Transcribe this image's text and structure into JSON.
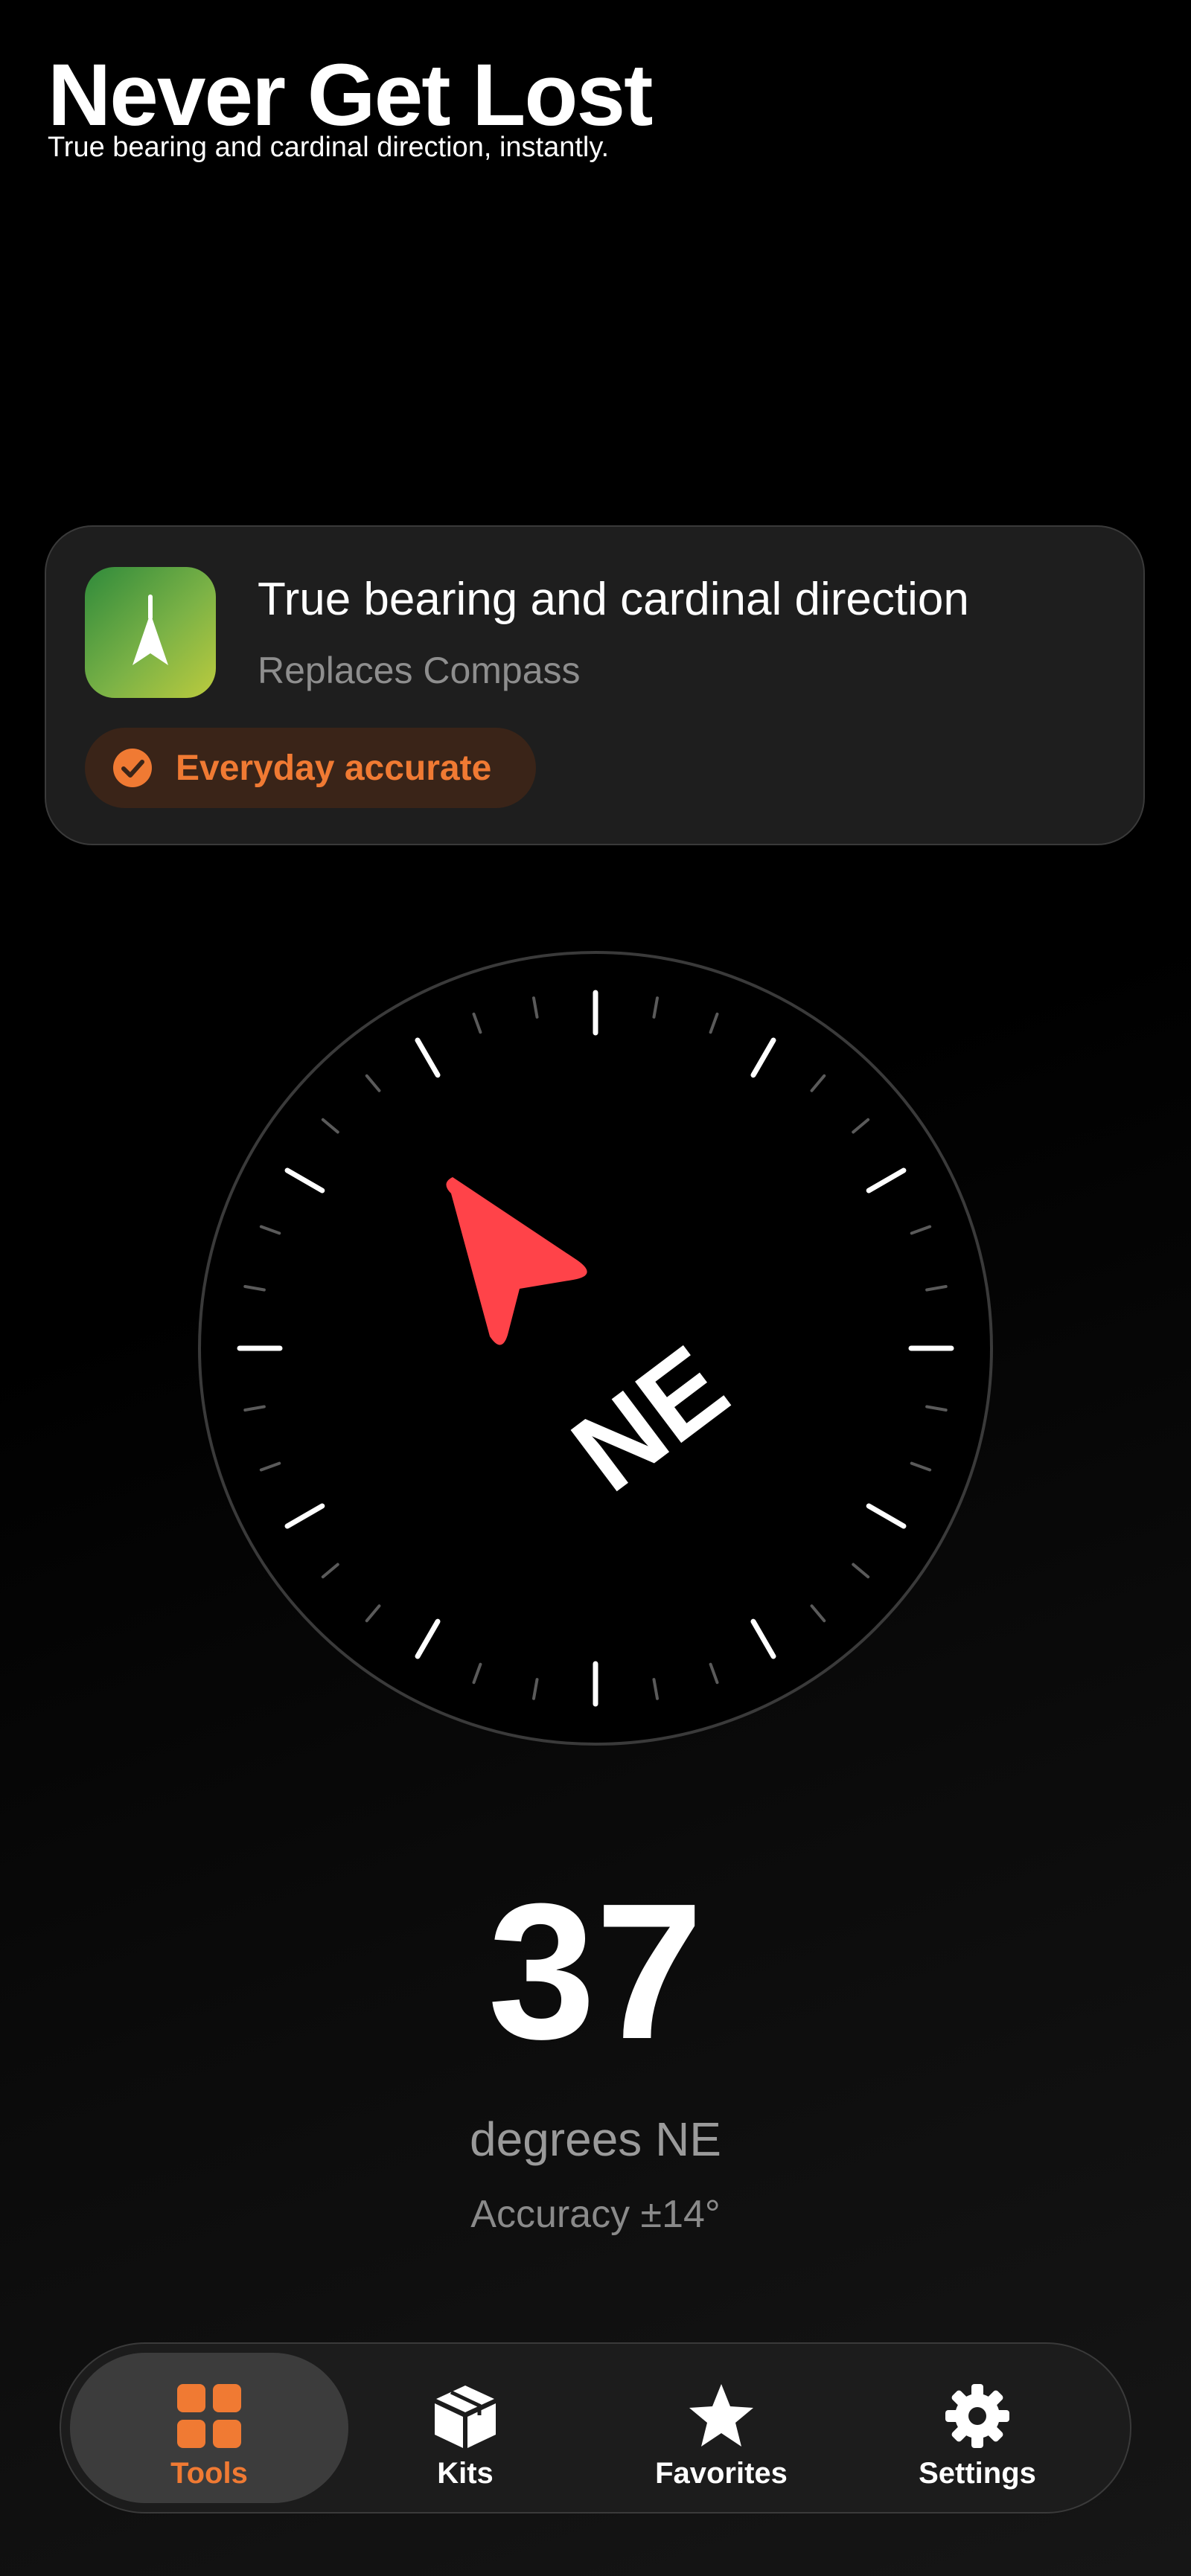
{
  "header": {
    "title": "Never Get Lost",
    "subtitle": "True bearing and cardinal direction, instantly."
  },
  "card": {
    "icon": "compass-arrow-icon",
    "title": "True bearing and cardinal direction",
    "subtitle": "Replaces Compass",
    "badge": {
      "icon": "checkmark-circle-icon",
      "label": "Everyday accurate"
    }
  },
  "compass": {
    "heading_degrees": 37,
    "cardinal": "NE",
    "needle_color": "#ff4349"
  },
  "reading": {
    "degrees": "37",
    "unit_label": "degrees NE",
    "accuracy": "Accuracy ±14°"
  },
  "tabs": [
    {
      "label": "Tools",
      "icon": "grid-icon",
      "active": true
    },
    {
      "label": "Kits",
      "icon": "box-icon",
      "active": false
    },
    {
      "label": "Favorites",
      "icon": "star-icon",
      "active": false
    },
    {
      "label": "Settings",
      "icon": "gear-icon",
      "active": false
    }
  ],
  "colors": {
    "accent": "#f07a33",
    "needle": "#ff4349",
    "card_background": "#1e1e1e"
  }
}
